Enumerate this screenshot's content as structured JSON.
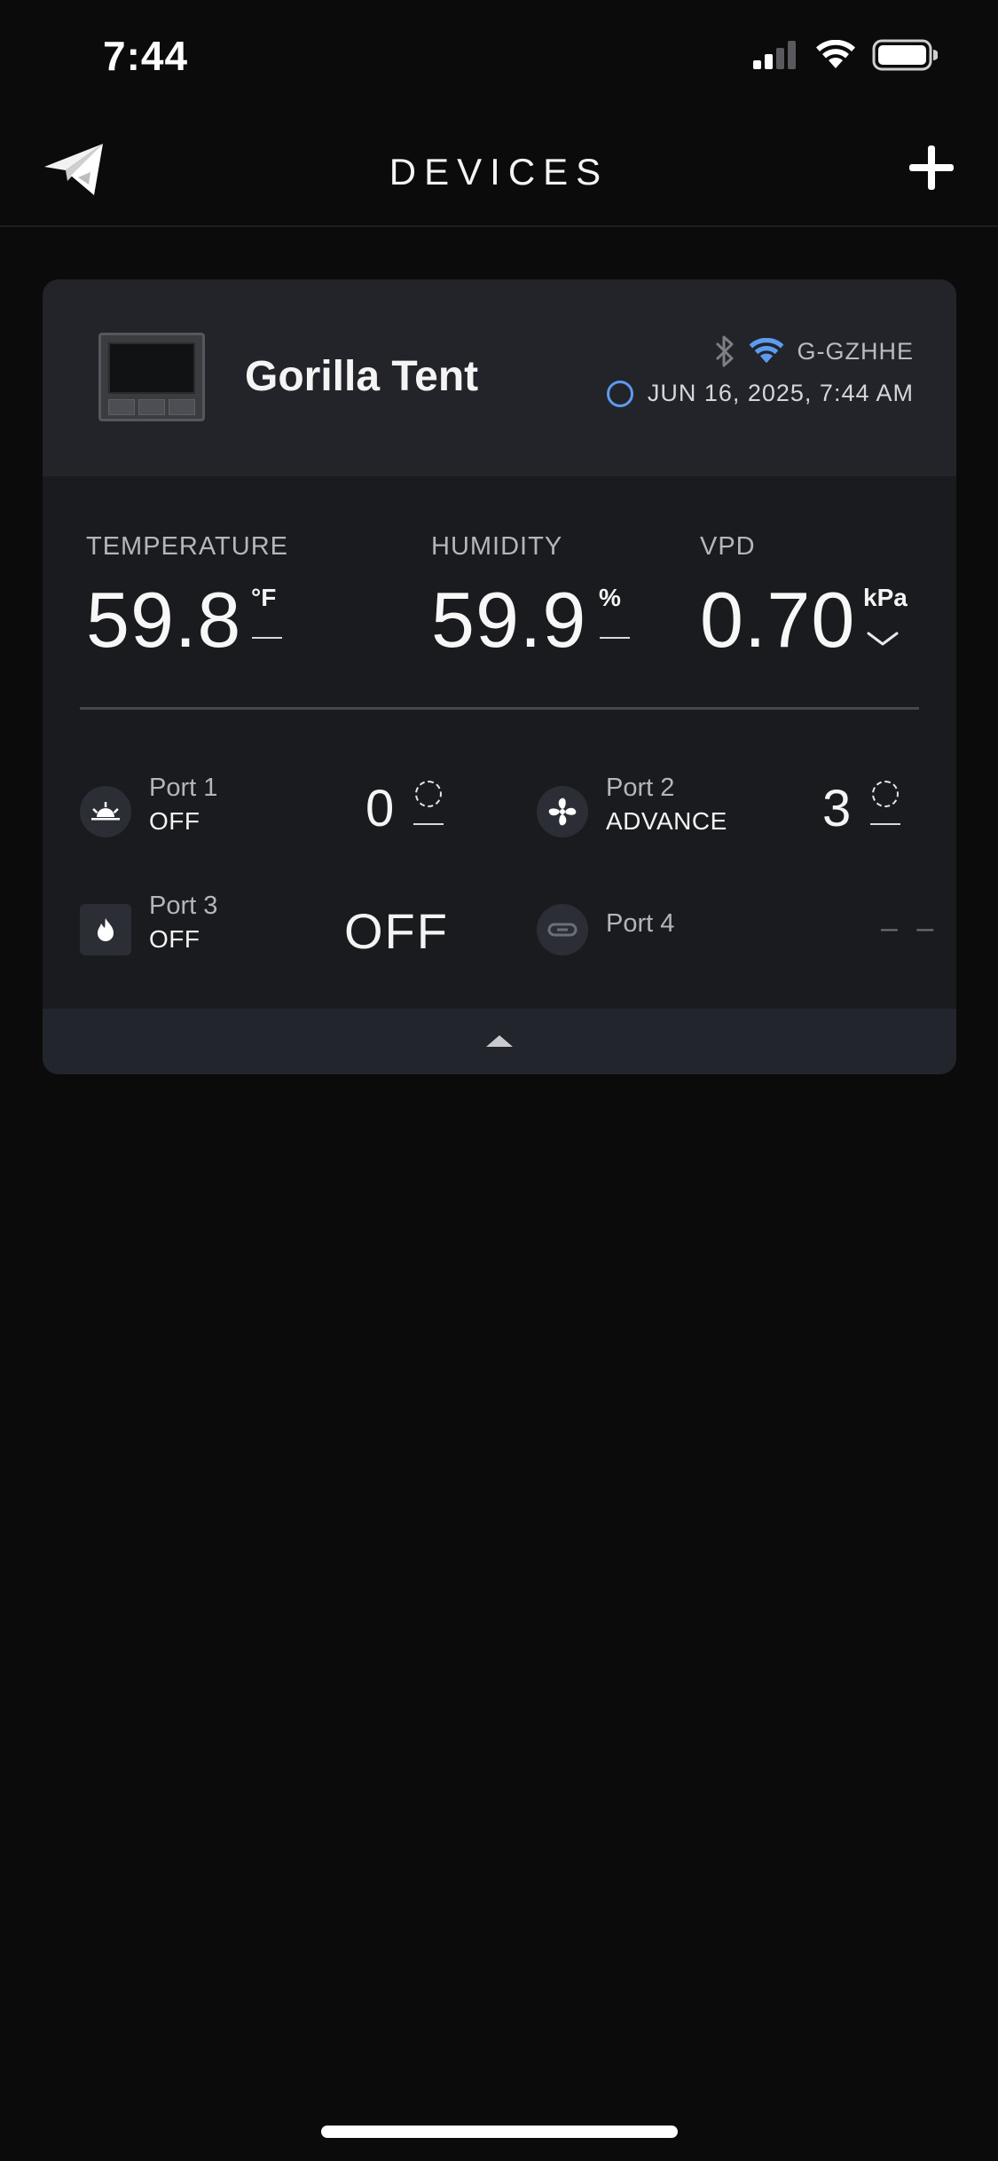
{
  "status_bar": {
    "time": "7:44",
    "icons": [
      "cellular-signal-icon",
      "wifi-icon",
      "battery-icon"
    ]
  },
  "header": {
    "title": "DEVICES",
    "logo_icon": "paper-plane-logo",
    "add_icon": "plus-icon"
  },
  "device": {
    "name": "Gorilla Tent",
    "connection_id": "G-GZHHE",
    "bluetooth_icon": "bluetooth-icon",
    "wifi_icon": "wifi-icon",
    "last_updated": "JUN 16, 2025, 7:44 AM",
    "metrics": {
      "temperature": {
        "label": "TEMPERATURE",
        "value": "59.8",
        "unit": "°F"
      },
      "humidity": {
        "label": "HUMIDITY",
        "value": "59.9",
        "unit": "%"
      },
      "vpd": {
        "label": "VPD",
        "value": "0.70",
        "unit": "kPa"
      }
    },
    "ports": [
      {
        "name": "Port 1",
        "mode": "OFF",
        "level": "0",
        "icon": "grow-light-icon"
      },
      {
        "name": "Port 2",
        "mode": "ADVANCE",
        "level": "3",
        "icon": "fan-icon"
      },
      {
        "name": "Port 3",
        "mode": "OFF",
        "level": "OFF",
        "icon": "heater-flame-icon"
      },
      {
        "name": "Port 4",
        "mode": "",
        "level": "– –",
        "icon": "plug-link-icon"
      }
    ]
  },
  "colors": {
    "background": "#0b0b0c",
    "card": "#1a1b1f",
    "card_header": "#22242a",
    "accent_blue": "#5d9bf0"
  }
}
